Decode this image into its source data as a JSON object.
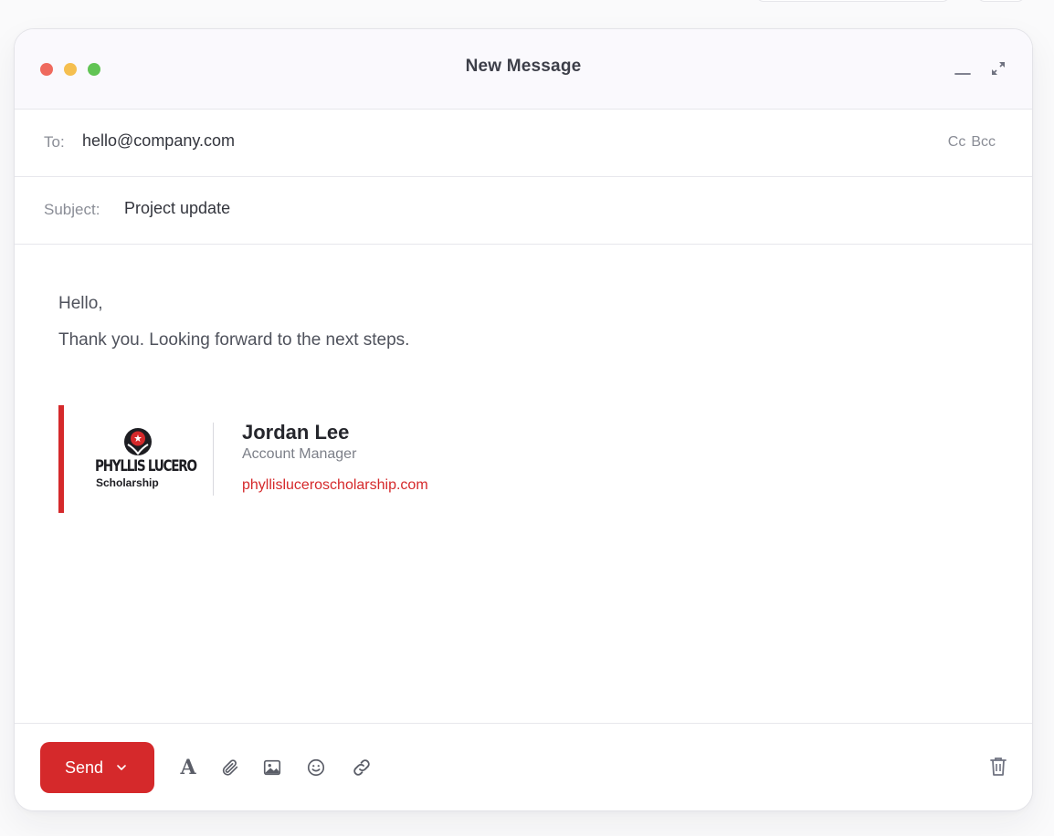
{
  "window": {
    "title": "New Message",
    "traffic_lights": [
      "#ef6a5e",
      "#f5bf4f",
      "#61c454"
    ]
  },
  "compose": {
    "to_label": "To:",
    "to_value": "hello@company.com",
    "cc_label": "Cc",
    "bcc_label": "Bcc",
    "subject_label": "Subject:",
    "subject_value": "Project update"
  },
  "body": {
    "lines": [
      "Hello,",
      "Thank you. Looking forward to the next steps."
    ]
  },
  "signature": {
    "logo_name": "PHYLLIS LUCERO",
    "logo_sub": "Scholarship",
    "name": "Jordan Lee",
    "role": "Account Manager",
    "website": "phyllisluceroscholarship.com",
    "accent_color": "#d5292b"
  },
  "footer": {
    "send_label": "Send",
    "tools": [
      "format-text-icon",
      "attach-icon",
      "image-icon",
      "emoji-icon",
      "link-icon"
    ],
    "trash_icon": "trash-icon"
  }
}
